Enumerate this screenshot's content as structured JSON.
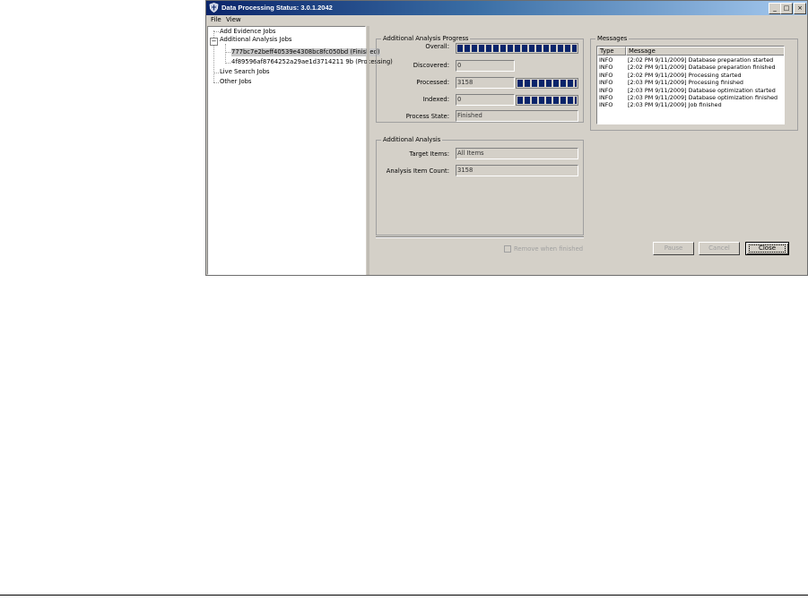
{
  "window": {
    "title": "Data Processing Status: 3.0.1.2042",
    "controls": {
      "minimize": "_",
      "maximize": "□",
      "close": "×"
    }
  },
  "menu": {
    "items": [
      "File",
      "View"
    ]
  },
  "tree": {
    "add_evidence": "Add Evidence Jobs",
    "additional_analysis": "Additional Analysis Jobs",
    "job1": "777bc7e2beff40539e4308bc8fc050bd (Finished)",
    "job2": "4f89596af8764252a29ae1d3714211 9b (Processing)",
    "live_search": "Live Search Jobs",
    "other": "Other Jobs",
    "expander": "−"
  },
  "progress": {
    "group_title": "Additional Analysis Progress",
    "overall_label": "Overall:",
    "discovered_label": "Discovered:",
    "discovered_value": "0",
    "processed_label": "Processed:",
    "processed_value": "3158",
    "indexed_label": "Indexed:",
    "indexed_value": "0",
    "state_label": "Process State:",
    "state_value": "Finished",
    "overall_fraction": 1.0,
    "processed_fraction": 1.0,
    "indexed_fraction": 1.0
  },
  "analysis": {
    "group_title": "Additional Analysis",
    "target_label": "Target Items:",
    "target_value": "All Items",
    "count_label": "Analysis Item Count:",
    "count_value": "3158"
  },
  "messages": {
    "group_title": "Messages",
    "col_type": "Type",
    "col_message": "Message",
    "rows": [
      {
        "type": "INFO",
        "message": "[2:02 PM 9/11/2009] Database preparation started"
      },
      {
        "type": "INFO",
        "message": "[2:02 PM 9/11/2009] Database preparation finished"
      },
      {
        "type": "INFO",
        "message": "[2:02 PM 9/11/2009] Processing started"
      },
      {
        "type": "INFO",
        "message": "[2:03 PM 9/11/2009] Processing finished"
      },
      {
        "type": "INFO",
        "message": "[2:03 PM 9/11/2009] Database optimization started"
      },
      {
        "type": "INFO",
        "message": "[2:03 PM 9/11/2009] Database optimization finished"
      },
      {
        "type": "INFO",
        "message": "[2:03 PM 9/11/2009] Job finished"
      }
    ]
  },
  "controls": {
    "remove_when_finished": "Remove when finished",
    "pause": "Pause",
    "cancel": "Cancel",
    "close": "Close"
  },
  "colors": {
    "title_start": "#0a246a",
    "title_end": "#a6caf0",
    "progress_fill": "#0a246a",
    "window_bg": "#d4d0c8"
  }
}
